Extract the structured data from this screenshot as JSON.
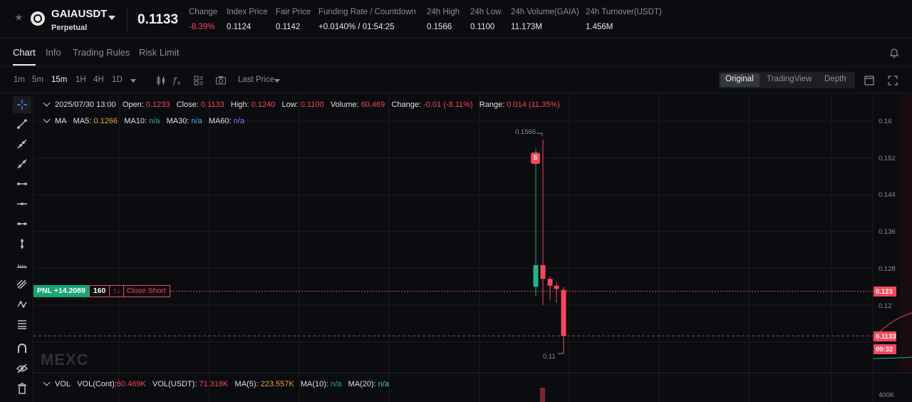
{
  "ticker": {
    "symbol": "GAIAUSDT",
    "contract_type": "Perpetual",
    "last_price": "0.1133",
    "stats": [
      {
        "label": "Change",
        "value": "-8.39%"
      },
      {
        "label": "Index Price",
        "value": "0.1124"
      },
      {
        "label": "Fair Price",
        "value": "0.1142"
      },
      {
        "label": "Funding Rate / Countdown",
        "value": "+0.0140% / 01:54:25"
      },
      {
        "label": "24h High",
        "value": "0.1566"
      },
      {
        "label": "24h Low",
        "value": "0.1100"
      },
      {
        "label": "24h Volume(GAIA)",
        "value": "11.173M"
      },
      {
        "label": "24h Turnover(USDT)",
        "value": "1.456M"
      }
    ]
  },
  "tabs": [
    "Chart",
    "Info",
    "Trading Rules",
    "Risk Limit"
  ],
  "toolbar": {
    "timeframes": [
      "1m",
      "5m",
      "15m",
      "1H",
      "4H",
      "1D"
    ],
    "active_timeframe": "15m",
    "price_type": "Last Price",
    "views": [
      "Original",
      "TradingView",
      "Depth"
    ],
    "active_view": "Original"
  },
  "ohlc": {
    "time": "2025/07/30 13:00",
    "open_label": "Open:",
    "open": "0.1233",
    "close_label": "Close:",
    "close": "0.1133",
    "high_label": "High:",
    "high": "0.1240",
    "low_label": "Low:",
    "low": "0.1100",
    "volume_label": "Volume:",
    "volume": "60,469",
    "change_label": "Change:",
    "change": "-0.01 (-8.11%)",
    "range_label": "Range:",
    "range": "0.014 (11.35%)"
  },
  "ma": {
    "title": "MA",
    "ma5_label": "MA5:",
    "ma5": "0.1266",
    "ma10_label": "MA10:",
    "ma10": "n/a",
    "ma30_label": "MA30:",
    "ma30": "n/a",
    "ma60_label": "MA60:",
    "ma60": "n/a"
  },
  "vol": {
    "title": "VOL",
    "cont_label": "VOL(Cont):",
    "cont": "60.469K",
    "usdt_label": "VOL(USDT):",
    "usdt": "71.318K",
    "ma5_label": "MA(5):",
    "ma5": "223.557K",
    "ma10_label": "MA(10):",
    "ma10": "n/a",
    "ma20_label": "MA(20):",
    "ma20": "n/a"
  },
  "position": {
    "pnl": "PNL +14.2089",
    "quantity": "160",
    "action": "Close Short",
    "arrows": "↑↓"
  },
  "price_axis": [
    "0.16",
    "0.152",
    "0.144",
    "0.136",
    "0.128",
    "0.12"
  ],
  "volume_axis_label": "400K",
  "price_tags": {
    "entry": "0.123",
    "current": "0.1133",
    "countdown": "09:32"
  },
  "chart_annotations": {
    "high_marker": "0.1566",
    "low_marker": "0.11",
    "signal_badge": "S"
  },
  "watermark": "MEXC",
  "colors": {
    "up": "#26b283",
    "down": "#f6465d",
    "ma5": "#f0a030",
    "background": "#0b0c0f"
  },
  "chart_data": {
    "type": "candlestick",
    "candles": [
      {
        "open": 0.124,
        "close": 0.1287,
        "high": 0.154,
        "low": 0.122,
        "dir": "up"
      },
      {
        "open": 0.1287,
        "close": 0.1257,
        "high": 0.156,
        "low": 0.12,
        "dir": "down"
      },
      {
        "open": 0.1257,
        "close": 0.1242,
        "high": 0.1262,
        "low": 0.121,
        "dir": "down"
      },
      {
        "open": 0.1242,
        "close": 0.1235,
        "high": 0.125,
        "low": 0.1205,
        "dir": "down"
      },
      {
        "open": 0.1233,
        "close": 0.1133,
        "high": 0.124,
        "low": 0.11,
        "dir": "down"
      }
    ],
    "ylim": [
      0.105,
      0.165
    ],
    "grid": true
  }
}
